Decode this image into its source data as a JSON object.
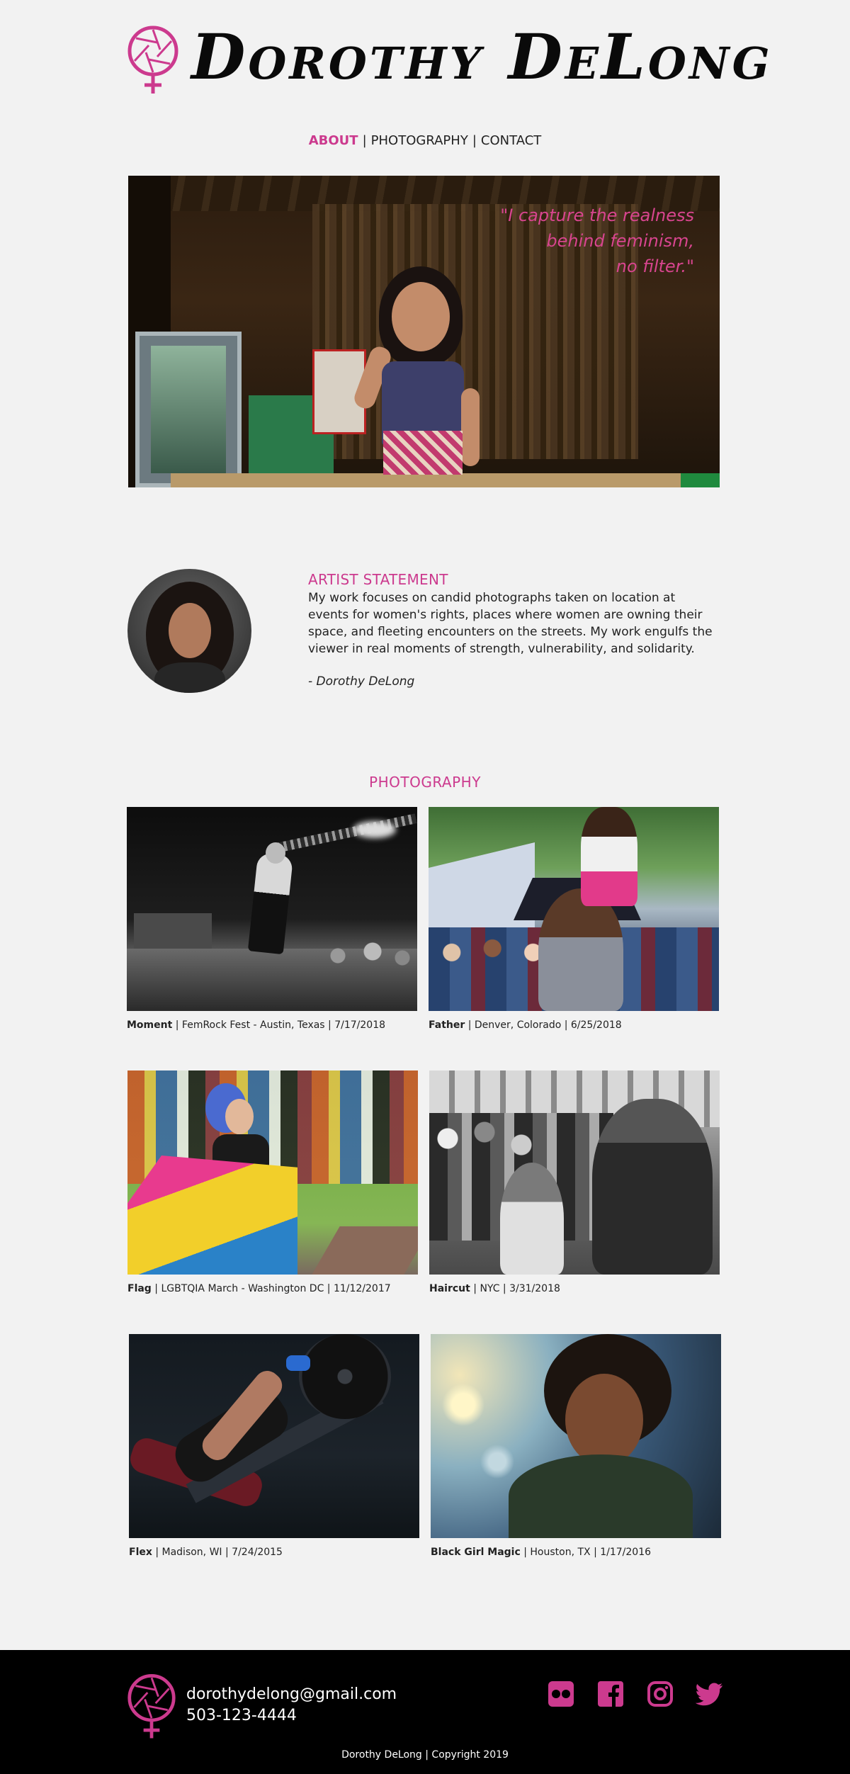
{
  "brand": {
    "name": "Dorothy DeLong",
    "accent_color": "#cc3a8e",
    "logo_icon": "aperture-female-symbol-icon"
  },
  "nav": {
    "items": [
      {
        "label": "ABOUT",
        "active": true
      },
      {
        "label": "PHOTOGRAPHY",
        "active": false
      },
      {
        "label": "CONTACT",
        "active": false
      }
    ],
    "separator": "|"
  },
  "hero": {
    "quote_lines": [
      "\"I capture the realness",
      "behind feminism,",
      "no filter.\""
    ]
  },
  "statement": {
    "heading": "ARTIST STATEMENT",
    "body": "My work focuses on candid photographs taken on location at events for women's rights, places where women are owning their space, and fleeting encounters on the streets. My work engulfs the viewer in real moments of strength, vulnerability, and solidarity.",
    "signature": "- Dorothy DeLong"
  },
  "photography": {
    "heading": "PHOTOGRAPHY",
    "photos": [
      {
        "title": "Moment",
        "details": " | FemRock Fest - Austin, Texas | 7/17/2018"
      },
      {
        "title": "Father",
        "details": " | Denver, Colorado | 6/25/2018"
      },
      {
        "title": "Flag",
        "details": " | LGBTQIA March - Washington DC | 11/12/2017"
      },
      {
        "title": "Haircut",
        "details": " | NYC | 3/31/2018"
      },
      {
        "title": "Flex",
        "details": " | Madison, WI | 7/24/2015"
      },
      {
        "title": "Black Girl Magic",
        "details": " | Houston, TX | 1/17/2016"
      }
    ]
  },
  "footer": {
    "email": "dorothydelong@gmail.com",
    "phone": "503-123-4444",
    "socials": [
      "flickr-icon",
      "facebook-icon",
      "instagram-icon",
      "twitter-icon"
    ],
    "copyright": "Dorothy DeLong | Copyright 2019"
  }
}
